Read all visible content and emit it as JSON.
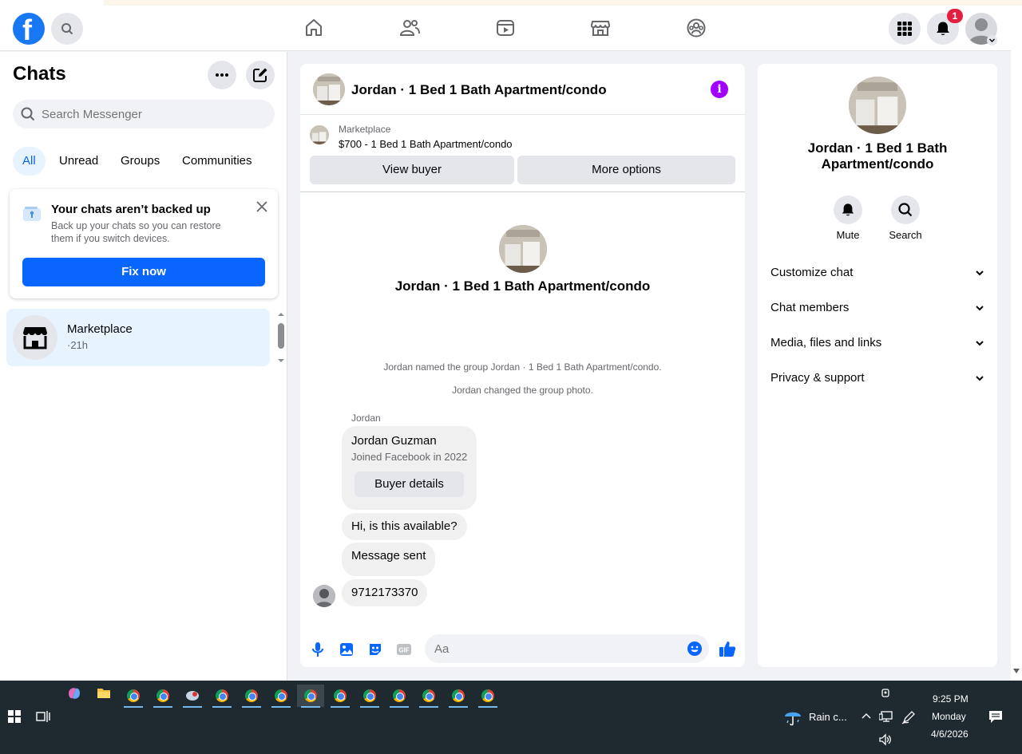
{
  "colors": {
    "brand": "#1877f2",
    "accent": "#0866ff",
    "info": "#a100ff",
    "badge": "#e41e3f"
  },
  "header": {
    "logo": "f",
    "notifications_count": "1",
    "nav_icons": [
      "home-icon",
      "friends-icon",
      "video-icon",
      "marketplace-icon",
      "groups-icon"
    ]
  },
  "sidebar": {
    "title": "Chats",
    "search_placeholder": "Search Messenger",
    "tabs": [
      {
        "label": "All",
        "active": true
      },
      {
        "label": "Unread"
      },
      {
        "label": "Groups"
      },
      {
        "label": "Communities"
      }
    ],
    "backup": {
      "title": "Your chats aren’t backed up",
      "text": "Back up your chats so you can restore them if you switch devices.",
      "button": "Fix now"
    },
    "chat": {
      "name": "Marketplace",
      "time": "·21h"
    }
  },
  "conversation": {
    "title": "Jordan · 1 Bed 1 Bath Apartment/condo",
    "marketplace_label": "Marketplace",
    "listing": "$700 - 1 Bed 1 Bath Apartment/condo",
    "view_buyer": "View buyer",
    "more_options": "More options",
    "center_title": "Jordan · 1 Bed 1 Bath Apartment/condo",
    "system_messages": [
      "Jordan named the group Jordan · 1 Bed 1 Bath Apartment/condo.",
      "Jordan changed the group photo."
    ],
    "sender": "Jordan",
    "profile": {
      "name": "Jordan Guzman",
      "sub": "Joined Facebook in 2022",
      "button": "Buyer details"
    },
    "messages": [
      "Hi, is this available?",
      "Message sent",
      "9712173370"
    ],
    "input_placeholder": "Aa"
  },
  "right_panel": {
    "title": "Jordan · 1 Bed 1 Bath Apartment/condo",
    "actions": [
      "Mute",
      "Search"
    ],
    "sections": [
      "Customize chat",
      "Chat members",
      "Media, files and links",
      "Privacy & support"
    ]
  },
  "taskbar": {
    "weather": "Rain c...",
    "time": "9:25 PM",
    "day": "Monday",
    "date": "4/6/2026"
  }
}
